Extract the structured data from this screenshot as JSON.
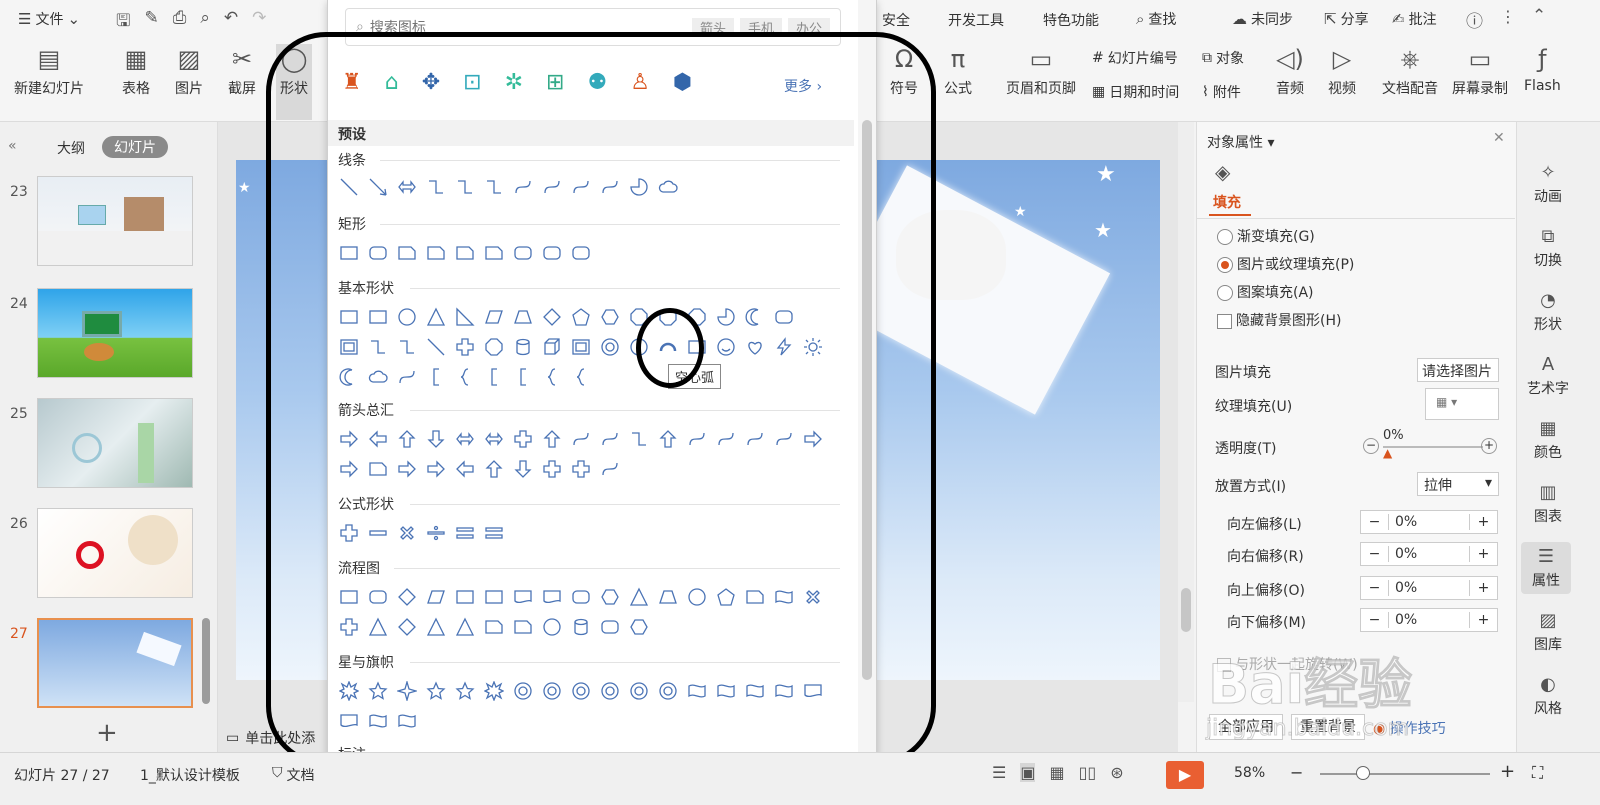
{
  "colors": {
    "accent": "#d9541e",
    "shape_stroke": "#4a73b5",
    "highlight_ring": "#000000"
  },
  "topbar": {
    "file_label": "文件",
    "menu_items": [
      "安全",
      "开发工具",
      "特色功能"
    ],
    "search_label": "查找",
    "sync_label": "未同步",
    "share_label": "分享",
    "comment_label": "批注"
  },
  "ribbon": {
    "new_slide": "新建幻灯片",
    "table": "表格",
    "picture": "图片",
    "screenshot": "截屏",
    "shape": "形状",
    "symbol": "符号",
    "formula": "公式",
    "header_footer": "页眉和页脚",
    "slide_number": "幻灯片编号",
    "object": "对象",
    "date_time": "日期和时间",
    "attachment": "附件",
    "audio": "音频",
    "video": "视频",
    "narration": "文档配音",
    "screen_record": "屏幕录制",
    "flash": "Flash"
  },
  "left_panel": {
    "tab_outline": "大纲",
    "tab_slides": "幻灯片",
    "slides": [
      "23",
      "24",
      "25",
      "26",
      "27"
    ],
    "add_label": "+"
  },
  "canvas": {
    "notes_placeholder": "单击此处添"
  },
  "shape_panel": {
    "search_placeholder": "搜索图标",
    "search_tags": [
      "箭头",
      "手机",
      "办公"
    ],
    "more_label": "更多",
    "preset_label": "预设",
    "sections": [
      "线条",
      "矩形",
      "基本形状",
      "箭头总汇",
      "公式形状",
      "流程图",
      "星与旗帜",
      "标注"
    ],
    "tooltip": "空心弧"
  },
  "right_panel": {
    "title": "对象属性",
    "tab_fill": "填充",
    "opt_gradient": "渐变填充(G)",
    "opt_picture": "图片或纹理填充(P)",
    "opt_pattern": "图案填充(A)",
    "opt_hide_bg": "隐藏背景图形(H)",
    "picture_fill_label": "图片填充",
    "picture_fill_btn": "请选择图片",
    "texture_fill_label": "纹理填充(U)",
    "transparency_label": "透明度(T)",
    "transparency_value": "0%",
    "placement_label": "放置方式(I)",
    "placement_value": "拉伸",
    "offset_left": "向左偏移(L)",
    "offset_right": "向右偏移(R)",
    "offset_up": "向上偏移(O)",
    "offset_down": "向下偏移(M)",
    "offset_value": "0%",
    "rotate_with_shape": "与形状一起旋转(W)",
    "apply_all": "全部应用",
    "reset_bg": "重置背景",
    "tips": "操作技巧"
  },
  "sidebar": {
    "items": [
      "动画",
      "切换",
      "形状",
      "艺术字",
      "颜色",
      "图表",
      "属性",
      "图库",
      "风格"
    ]
  },
  "statusbar": {
    "slide_count": "幻灯片 27 / 27",
    "template": "1_默认设计模板",
    "doc_protect": "文档",
    "zoom": "58%"
  },
  "watermark": {
    "brand": "Bai经验",
    "url": "jingyan.baidu.com"
  }
}
